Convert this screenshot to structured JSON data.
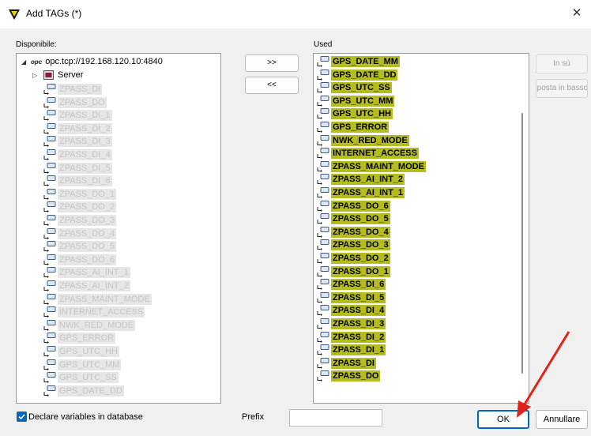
{
  "window": {
    "title": "Add TAGs (*)",
    "close_glyph": "✕"
  },
  "left_panel": {
    "label": "Disponibile:",
    "root": "opc.tcp://192.168.120.10:4840",
    "root_logo": "opc",
    "server": "Server",
    "items": [
      "ZPASS_DI",
      "ZPASS_DO",
      "ZPASS_DI_1",
      "ZPASS_DI_2",
      "ZPASS_DI_3",
      "ZPASS_DI_4",
      "ZPASS_DI_5",
      "ZPASS_DI_6",
      "ZPASS_DO_1",
      "ZPASS_DO_2",
      "ZPASS_DO_3",
      "ZPASS_DO_4",
      "ZPASS_DO_5",
      "ZPASS_DO_6",
      "ZPASS_AI_INT_1",
      "ZPASS_AI_INT_2",
      "ZPASS_MAINT_MODE",
      "INTERNET_ACCESS",
      "NWK_RED_MODE",
      "GPS_ERROR",
      "GPS_UTC_HH",
      "GPS_UTC_MM",
      "GPS_UTC_SS",
      "GPS_DATE_DD"
    ]
  },
  "right_panel": {
    "label": "Used",
    "items": [
      "GPS_DATE_MM",
      "GPS_DATE_DD",
      "GPS_UTC_SS",
      "GPS_UTC_MM",
      "GPS_UTC_HH",
      "GPS_ERROR",
      "NWK_RED_MODE",
      "INTERNET_ACCESS",
      "ZPASS_MAINT_MODE",
      "ZPASS_AI_INT_2",
      "ZPASS_AI_INT_1",
      "ZPASS_DO_6",
      "ZPASS_DO_5",
      "ZPASS_DO_4",
      "ZPASS_DO_3",
      "ZPASS_DO_2",
      "ZPASS_DO_1",
      "ZPASS_DI_6",
      "ZPASS_DI_5",
      "ZPASS_DI_4",
      "ZPASS_DI_3",
      "ZPASS_DI_2",
      "ZPASS_DI_1",
      "ZPASS_DI",
      "ZPASS_DO"
    ]
  },
  "buttons": {
    "add": ">>",
    "remove": "<<",
    "up": "In sù",
    "down": "Sposta in basso",
    "ok": "OK",
    "cancel": "Annullare"
  },
  "footer": {
    "declare_label": "Declare variables in database",
    "declare_checked": true,
    "prefix_label": "Prefix",
    "prefix_value": ""
  },
  "colors": {
    "highlight": "#b5bd1e",
    "accent": "#0067c0",
    "arrow": "#e0241b"
  }
}
